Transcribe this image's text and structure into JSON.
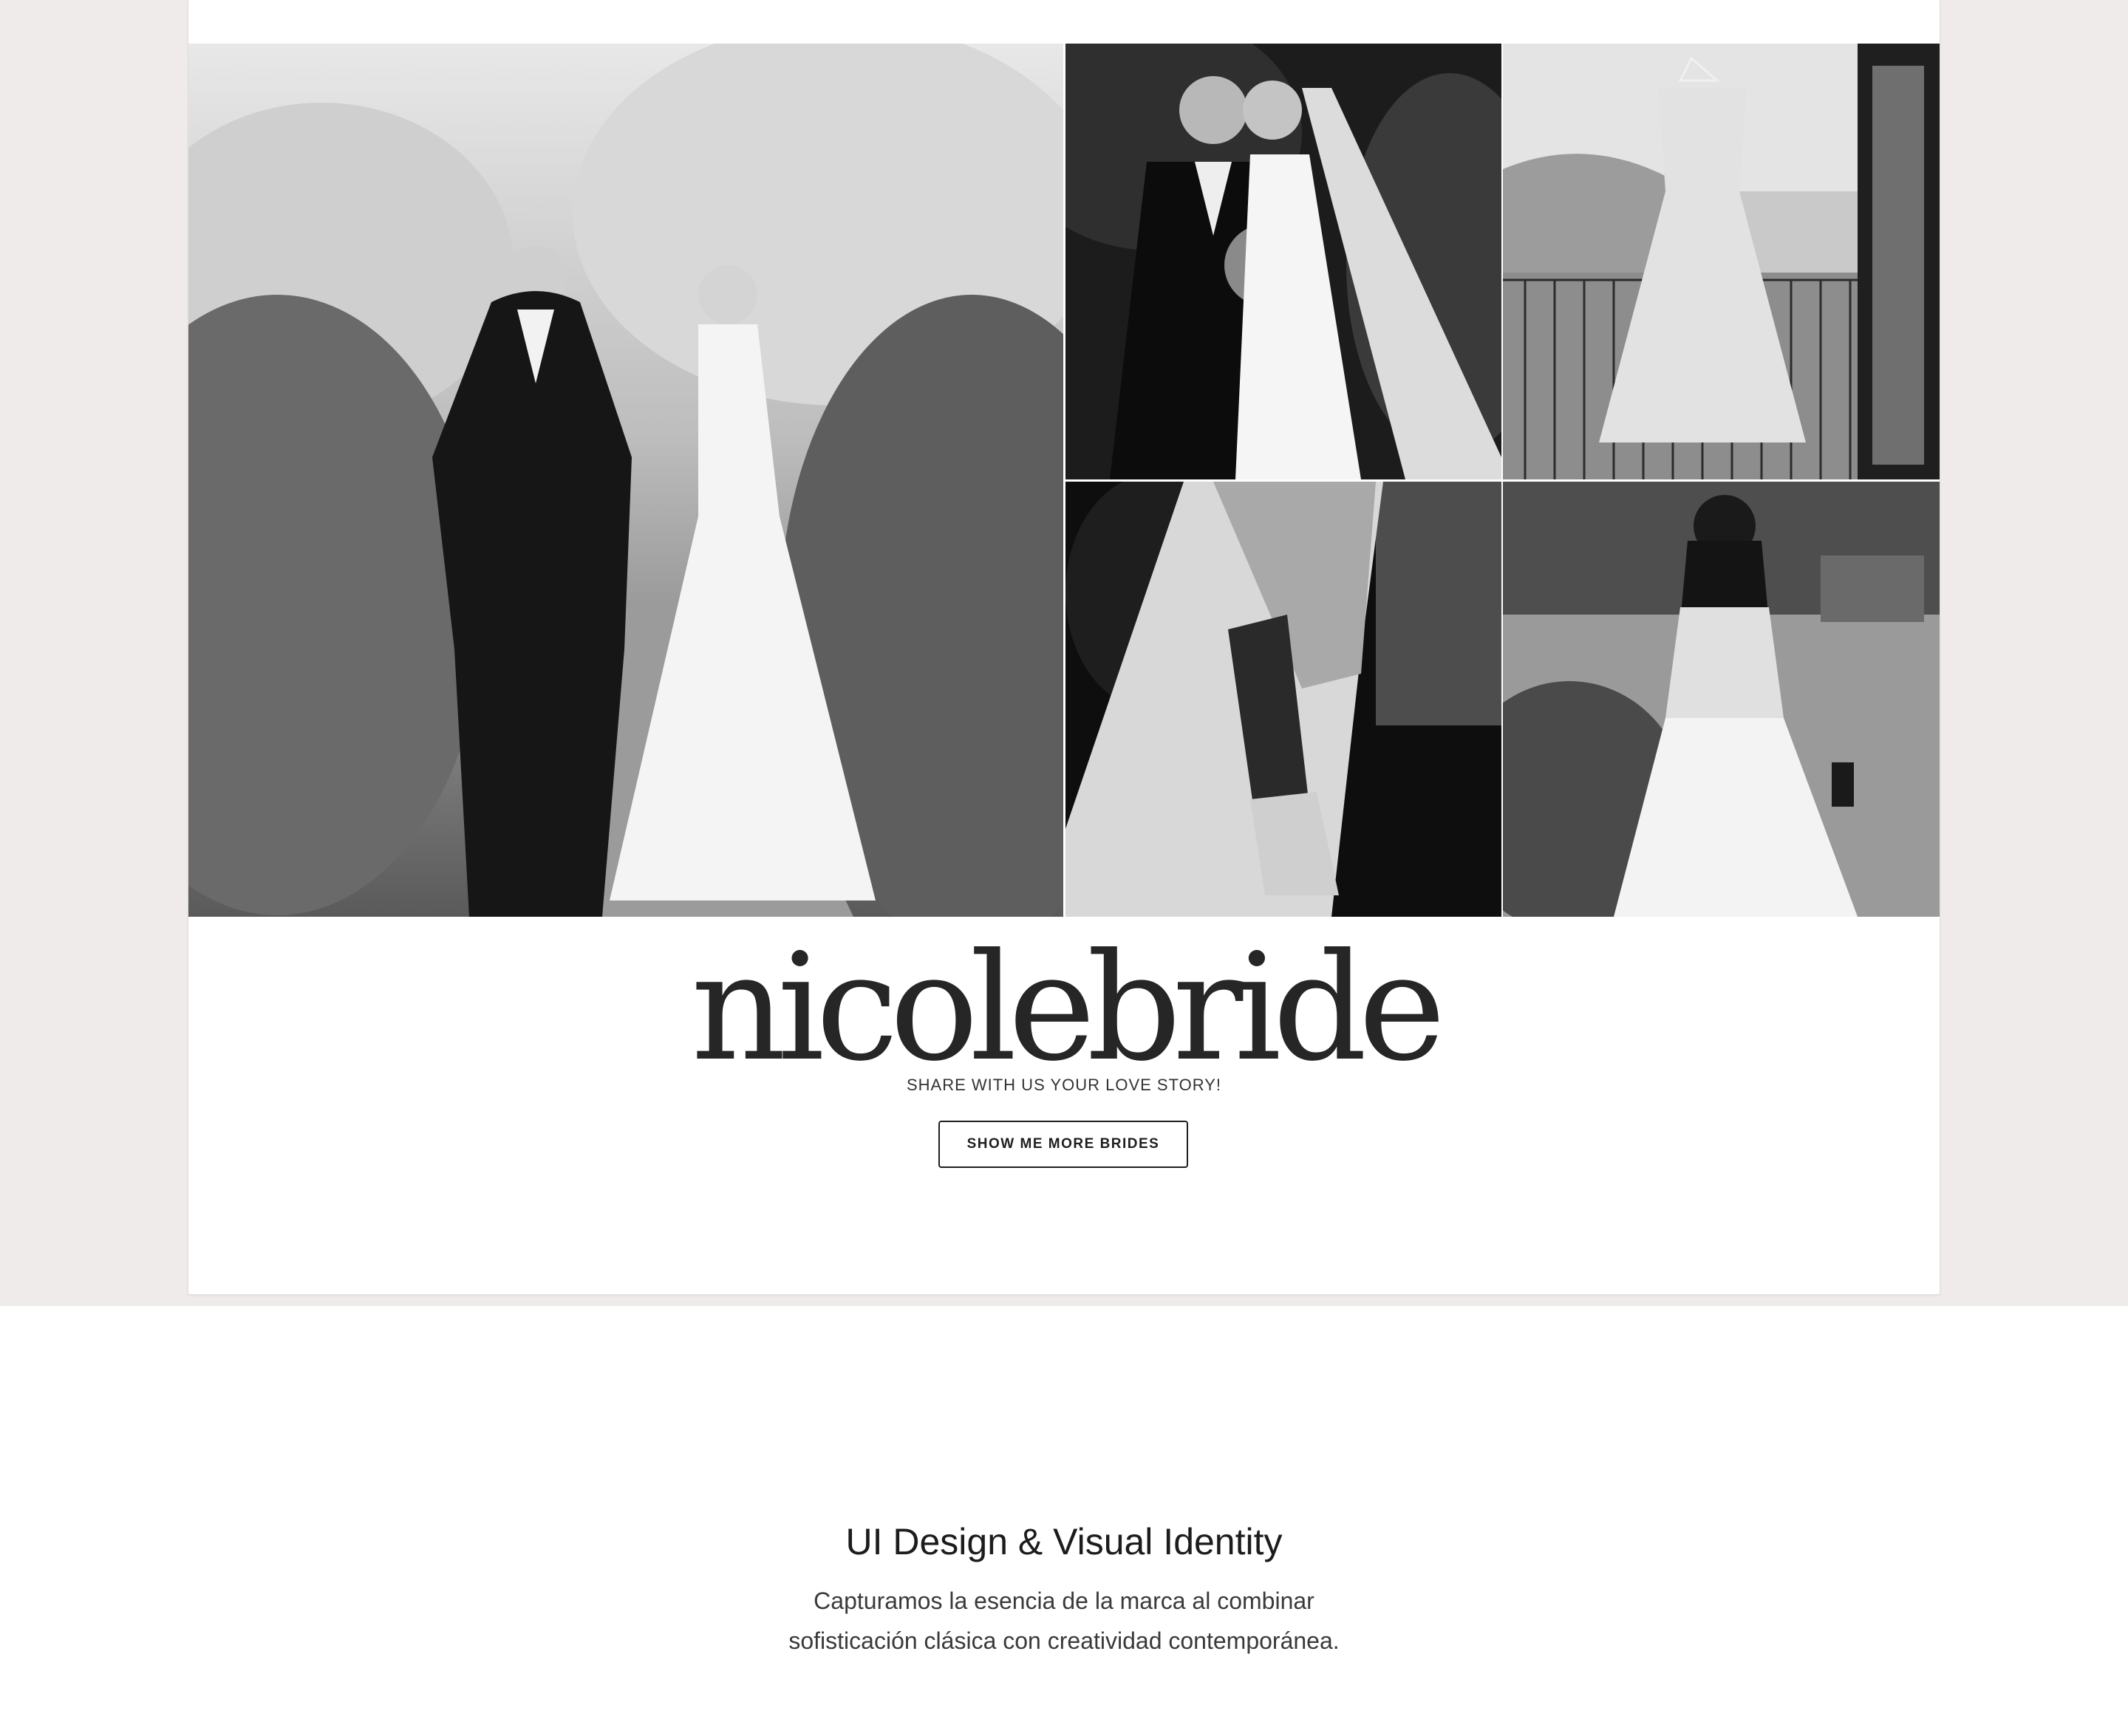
{
  "gallery": {
    "images": [
      {
        "name": "couple-standing-garden-photo"
      },
      {
        "name": "couple-kissing-photo"
      },
      {
        "name": "dress-hanging-balcony-photo"
      },
      {
        "name": "bride-fastening-shoe-photo"
      },
      {
        "name": "bride-back-walking-photo"
      }
    ]
  },
  "brand": {
    "logo": "nicolebride",
    "tagline": "SHARE WITH US YOUR LOVE STORY!",
    "cta_label": "SHOW ME MORE BRIDES"
  },
  "section": {
    "title": "UI Design & Visual Identity",
    "description_line1": "Capturamos la esencia de la marca al combinar",
    "description_line2": "sofisticación clásica con creatividad contemporánea."
  },
  "colors": {
    "page_band": "#efebeb",
    "card": "#ffffff",
    "text_dark": "#262626",
    "button_border": "#1e1e1e"
  }
}
